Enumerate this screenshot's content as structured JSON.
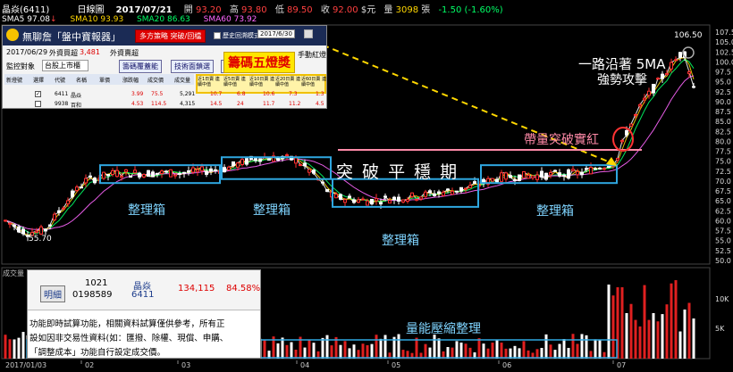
{
  "header": {
    "stock": "晶焱(6411)",
    "chart_label": "日線圖",
    "date": "2017/07/21",
    "open_label": "開",
    "open": "93.20",
    "high_label": "高",
    "high": "93.80",
    "low_label": "低",
    "low": "89.50",
    "close_label": "收",
    "close": "92.00",
    "currency": "$元",
    "volume_label": "量",
    "volume": "3098",
    "volume_unit": "張",
    "change": "-1.50",
    "change_pct": "(-1.60%)"
  },
  "ma_bar": {
    "sma5_label": "SMA5",
    "sma5": "97.08",
    "sma10_label": "SMA10",
    "sma10": "93.93",
    "sma20_label": "SMA20",
    "sma20": "86.63",
    "sma60_label": "SMA60",
    "sma60": "73.92",
    "colors": {
      "sma5": "#ffffff",
      "sma10": "#ffd700",
      "sma20": "#00ff66",
      "sma60": "#ff66ff"
    }
  },
  "popup": {
    "title": "無聊詹「盤中寶報器」",
    "btn_strategy": "多方策略 突破/回檔",
    "chk_history": "歷史回溯模式",
    "hist_date": "2017/6/30",
    "date_label": "2017/06/29",
    "query_label": "外資買超",
    "query_value": "3,481",
    "query2_label": "外資賣超",
    "monitor_label": "監控對象",
    "monitor_value": "台股上市櫃",
    "tab_a": "籌碼覆蓋能",
    "tab_b": "技術面鎖選",
    "tab_c": "基",
    "hand_label": "手動紅燈",
    "col_headers": [
      "新燈號",
      "選擇",
      "代號",
      "名稱",
      "單價",
      "漲跌幅",
      "成交價",
      "成交量"
    ],
    "lights_header": [
      "近1日賣 連續中值",
      "近5日賣 連續中值",
      "近10日賣 連續中值",
      "近20日賣 連續中值",
      "近60日賣 連續中值"
    ],
    "rows": [
      {
        "code": "6411",
        "name": "晶焱",
        "price": "3.99",
        "change": "75.5",
        "vol": "5,291",
        "lights": [
          "10.7",
          "6.8",
          "10.6",
          "7.3",
          "1.3"
        ]
      },
      {
        "code": "9938",
        "name": "百和",
        "price": "4.53",
        "change": "114.5",
        "vol": "4,315",
        "lights": [
          "14.5",
          "24",
          "11.7",
          "11.2",
          "4.5"
        ]
      }
    ],
    "badge": "籌碼五燈獎"
  },
  "annotations": {
    "box_label": "整理箱",
    "breakout": "突 破 平 穩 期",
    "volume_break": "帶量突破實紅",
    "trend_line1": "一路沿著 5MA",
    "trend_line2": "強勢攻擊",
    "volume_shrink": "量能壓縮整理",
    "low_mark": "55.70",
    "high_mark": "106.50"
  },
  "lower_popup": {
    "detail_btn": "明細",
    "qty": "1021",
    "order": "0198589",
    "name": "晶焱",
    "code": "6411",
    "amount": "134,115",
    "pct": "84.58%",
    "note1": "功能即時試算功能，相關資料試算僅供參考，所有正",
    "note2": "設如因非交易性資料(如：匯撥、除權、現償、申購、",
    "note3": "「調整成本」功能自行設定成交價。"
  },
  "volume_panel": {
    "title": "成交量 3",
    "tick_10k": "10K",
    "tick_5k": "5K"
  },
  "x_axis": [
    "2017/01/03",
    "02",
    "03",
    "04",
    "05",
    "06",
    "07"
  ],
  "chart_data": {
    "type": "candlestick",
    "title": "晶焱(6411) 日線圖",
    "ylim": [
      50.0,
      107.5
    ],
    "y_ticks": [
      50.0,
      52.5,
      55.0,
      57.5,
      60.0,
      62.5,
      65.0,
      67.5,
      70.0,
      72.5,
      75.0,
      77.5,
      80.0,
      82.5,
      85.0,
      87.5,
      90.0,
      92.5,
      95.0,
      97.5,
      100.0,
      102.5,
      105.0,
      107.5
    ],
    "months": [
      "2017/01/03",
      "02",
      "03",
      "04",
      "05",
      "06",
      "07"
    ],
    "ma_lines": [
      {
        "name": "SMA5",
        "color": "#ffffff"
      },
      {
        "name": "SMA10",
        "color": "#ffd700"
      },
      {
        "name": "SMA20",
        "color": "#00ff66"
      },
      {
        "name": "SMA60",
        "color": "#ff66ff"
      }
    ],
    "consolidation_boxes": [
      {
        "label": "整理箱",
        "from": "2017-02",
        "to": "2017-03",
        "low": 69.5,
        "high": 74.0
      },
      {
        "label": "整理箱",
        "from": "2017-03",
        "to": "2017-04",
        "low": 70.5,
        "high": 76.0
      },
      {
        "label": "整理箱",
        "from": "2017-04",
        "to": "2017-05",
        "low": 63.5,
        "high": 70.5
      },
      {
        "label": "整理箱",
        "from": "2017-06",
        "to": "2017-07",
        "low": 69.5,
        "high": 74.0
      }
    ],
    "low_value": 55.7,
    "high_value": 106.5,
    "last_close": 92.0
  }
}
